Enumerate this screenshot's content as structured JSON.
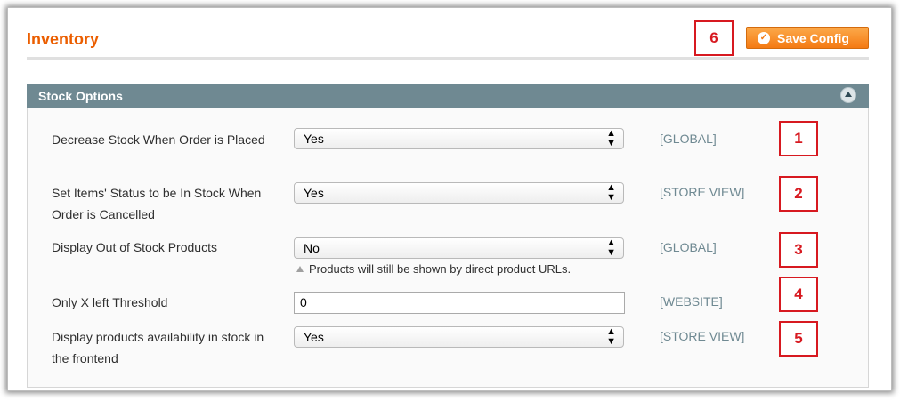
{
  "header": {
    "title": "Inventory",
    "save_label": "Save Config"
  },
  "section": {
    "title": "Stock Options"
  },
  "fields": [
    {
      "label": "Decrease Stock When Order is Placed",
      "value": "Yes",
      "scope": "[GLOBAL]"
    },
    {
      "label": "Set Items' Status to be In Stock When Order is Cancelled",
      "value": "Yes",
      "scope": "[STORE VIEW]"
    },
    {
      "label": "Display Out of Stock Products",
      "value": "No",
      "scope": "[GLOBAL]",
      "note": "Products will still be shown by direct product URLs."
    },
    {
      "label": "Only X left Threshold",
      "value": "0",
      "scope": "[WEBSITE]"
    },
    {
      "label": "Display products availability in stock in the frontend",
      "value": "Yes",
      "scope": "[STORE VIEW]"
    }
  ],
  "markers": [
    "1",
    "2",
    "3",
    "4",
    "5",
    "6"
  ],
  "colors": {
    "title": "#eb5e00",
    "section_header": "#6f8992",
    "button": "#f47a13",
    "marker": "#d71920",
    "scope": "#6f8992"
  }
}
